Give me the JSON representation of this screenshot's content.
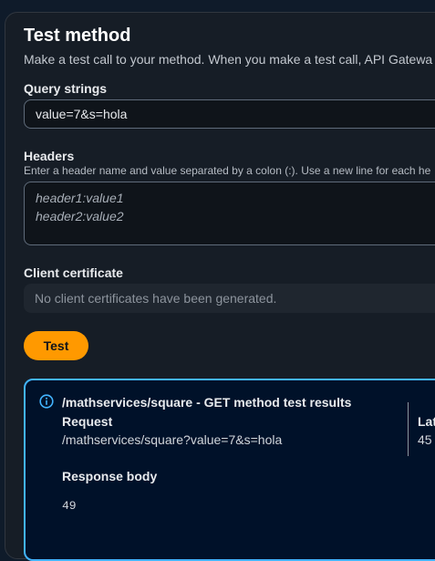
{
  "header": {
    "title": "Test method",
    "subtitle": "Make a test call to your method. When you make a test call, API Gatewa"
  },
  "query_strings": {
    "label": "Query strings",
    "value": "value=7&s=hola"
  },
  "headers_field": {
    "label": "Headers",
    "description": "Enter a header name and value separated by a colon (:). Use a new line for each he",
    "placeholder": "header1:value1\nheader2:value2"
  },
  "client_certificate": {
    "label": "Client certificate",
    "value": "No client certificates have been generated."
  },
  "test_button": {
    "label": "Test"
  },
  "results": {
    "title": "/mathservices/square - GET method test results",
    "request_label": "Request",
    "request_value": "/mathservices/square?value=7&s=hola",
    "latency_label": "Lat",
    "latency_value": "45",
    "response_body_label": "Response body",
    "response_body_value": "49"
  },
  "colors": {
    "accent": "#ff9900",
    "info": "#42b4ff"
  },
  "icons": {
    "info": "info-icon"
  }
}
